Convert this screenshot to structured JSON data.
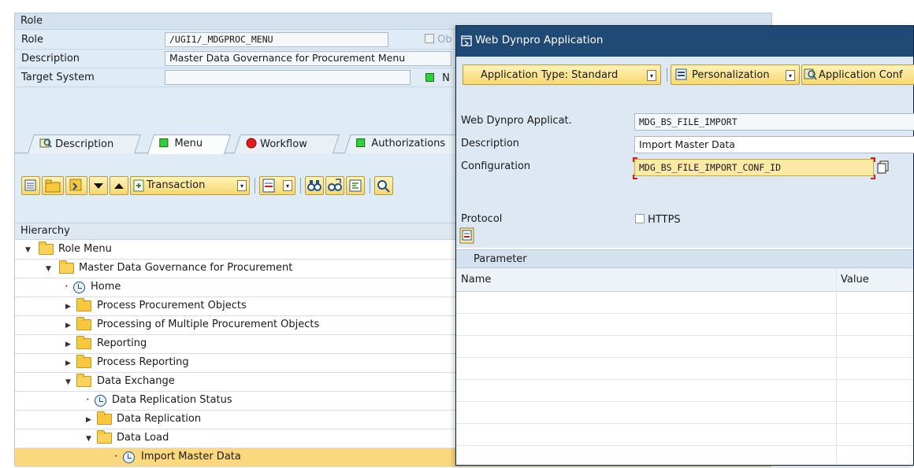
{
  "role_section": {
    "header": "Role",
    "role_label": "Role",
    "role_value": "/UGI1/_MDGPROC_MENU",
    "checkbox_label": "Ob",
    "description_label": "Description",
    "description_value": "Master Data Governance for Procurement Menu",
    "target_system_label": "Target System",
    "target_system_value": "",
    "status_letter": "N"
  },
  "tabs": [
    "Description",
    "Menu",
    "Workflow",
    "Authorizations"
  ],
  "toolbar": {
    "transaction_label": "Transaction"
  },
  "hierarchy": {
    "header": "Hierarchy",
    "items": [
      {
        "label": "Role Menu",
        "type": "folder-open",
        "expanded": true
      },
      {
        "label": "Master Data Governance for Procurement",
        "type": "folder-open",
        "expanded": true
      },
      {
        "label": "Home",
        "type": "app"
      },
      {
        "label": "Process  Procurement Objects",
        "type": "folder",
        "expanded": false
      },
      {
        "label": "Processing of Multiple Procurement Objects",
        "type": "folder",
        "expanded": false
      },
      {
        "label": "Reporting",
        "type": "folder",
        "expanded": false
      },
      {
        "label": "Process Reporting",
        "type": "folder",
        "expanded": false
      },
      {
        "label": "Data Exchange",
        "type": "folder-open",
        "expanded": true
      },
      {
        "label": "Data Replication Status",
        "type": "app"
      },
      {
        "label": "Data Replication",
        "type": "folder",
        "expanded": false
      },
      {
        "label": "Data Load",
        "type": "folder-open",
        "expanded": true
      },
      {
        "label": "Import Master Data",
        "type": "app",
        "selected": true
      }
    ]
  },
  "dialog": {
    "title": "Web Dynpro Application",
    "buttons": {
      "app_type": "Application Type: Standard",
      "personalization": "Personalization",
      "app_config": "Application Conf"
    },
    "fields": {
      "application_label": "Web Dynpro Applicat.",
      "application_value": "MDG_BS_FILE_IMPORT",
      "description_label": "Description",
      "description_value": "Import Master Data",
      "configuration_label": "Configuration",
      "configuration_value": "MDG_BS_FILE_IMPORT_CONF_ID",
      "protocol_label": "Protocol",
      "https_label": "HTTPS"
    },
    "parameter": {
      "header": "Parameter",
      "columns": [
        "Name",
        "Value"
      ]
    }
  },
  "colors": {
    "dialog_titlebar": "#1e4a75",
    "selection": "#fbd77d",
    "button_yellow": "#f6d871",
    "status_green": "#2fd339"
  }
}
